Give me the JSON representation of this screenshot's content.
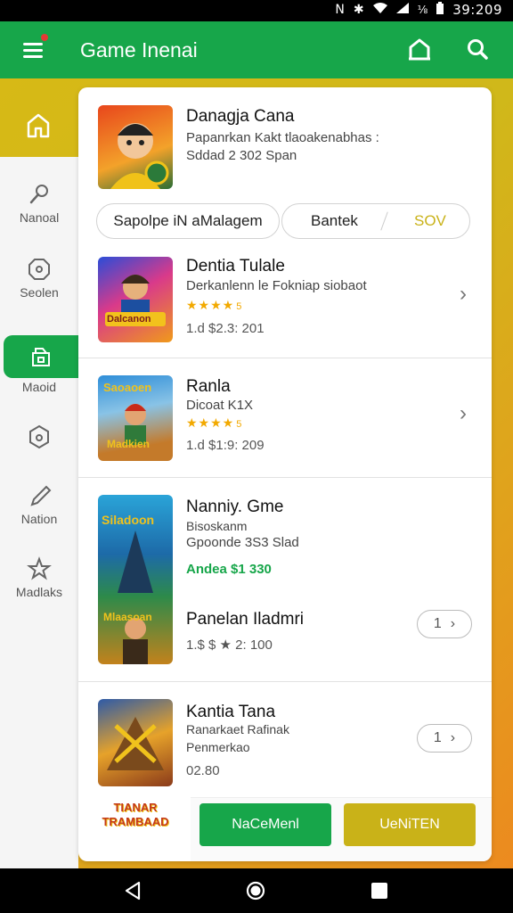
{
  "status_bar": {
    "time": "39:209",
    "icons": [
      "nfc-icon",
      "bluetooth-icon",
      "wifi-icon",
      "signal-icon",
      "battery-icon"
    ],
    "battery_label": "⅛"
  },
  "app_bar": {
    "title": "Game Inenai",
    "icons": [
      "menu-icon",
      "home-icon",
      "search-icon"
    ]
  },
  "sidebar": {
    "items": [
      {
        "label": "Nanoal",
        "icon": "racket-icon"
      },
      {
        "label": "Seolen",
        "icon": "octagon-icon"
      },
      {
        "label": "Maoid",
        "icon": "store-icon"
      },
      {
        "label": "",
        "icon": "shield-icon"
      },
      {
        "label": "Nation",
        "icon": "brush-icon"
      },
      {
        "label": "Madlaks",
        "icon": "star-icon"
      }
    ]
  },
  "featured": {
    "title": "Danagja Cana",
    "line1": "Papanrkan Kakt tlaoakenabhas :",
    "line2": "Sddad 2 302 Span"
  },
  "pills": {
    "left": "Sapolpe iN aMalagem",
    "middle": "Bantek",
    "right": "SOV"
  },
  "games": [
    {
      "title": "Dentia Tulale",
      "subtitle": "Derkanlenn le Fokniap siobaot",
      "rating_text": "5",
      "price": "1.d $2.3: 201"
    },
    {
      "title": "Ranla",
      "subtitle": "Dicoat K1X",
      "rating_text": "5",
      "price": "1.d $1:9: 209"
    },
    {
      "title": "Nanniy. Gme",
      "subtitle": "Bisoskanm",
      "subtitle2": "Gpoonde 3S3 Slad",
      "price_green": "Andea $1 330",
      "extra_title": "Panelan Iladmri",
      "extra_price": "1.$ $ ★ 2: 100",
      "stepper": "1"
    },
    {
      "title": "Kantia Tana",
      "subtitle": "Ranarkaet Rafinak",
      "subtitle2": "Penmerkao",
      "price": "02.80",
      "stepper": "1"
    }
  ],
  "thumb_art_text": {
    "g1": "Dalcanon",
    "g2a": "Saoaoen",
    "g2b": "Madkien",
    "g3a": "Siladoon",
    "g3b": "Mlaasoan",
    "footer_logo": "TIANAR TRAMBAAD"
  },
  "actions": {
    "primary": "NaCeMenl",
    "secondary": "UeNiTEN"
  },
  "colors": {
    "accent_green": "#17a64a",
    "accent_yellow": "#c9b218",
    "star": "#f2a900"
  }
}
